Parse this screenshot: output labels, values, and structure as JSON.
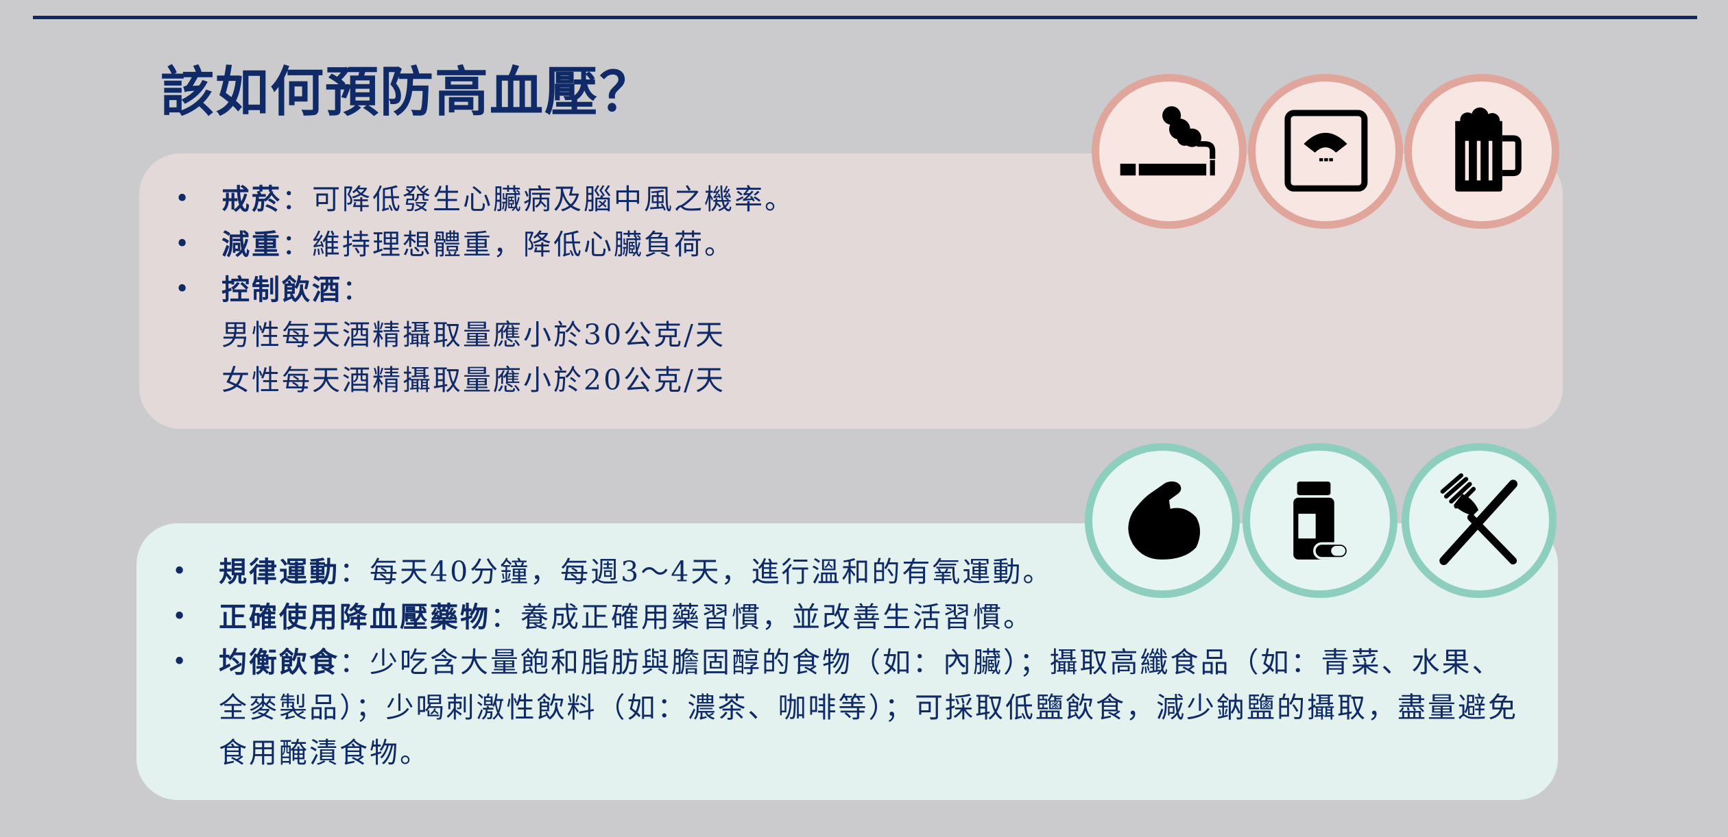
{
  "title": "該如何預防高血壓？",
  "top_section": {
    "items": [
      {
        "term": "戒菸",
        "text": "：可降低發生心臟病及腦中風之機率。",
        "sub": []
      },
      {
        "term": "減重",
        "text": "：維持理想體重，降低心臟負荷。",
        "sub": []
      },
      {
        "term": "控制飲酒",
        "text": "：",
        "sub": [
          "男性每天酒精攝取量應小於30公克/天",
          "女性每天酒精攝取量應小於20公克/天"
        ]
      }
    ],
    "icons": [
      "cigarette-icon",
      "weight-scale-icon",
      "beer-mug-icon"
    ]
  },
  "bottom_section": {
    "items": [
      {
        "term": "規律運動",
        "text": "：每天40分鐘，每週3～4天，進行溫和的有氧運動。"
      },
      {
        "term": "正確使用降血壓藥物",
        "text": "：養成正確用藥習慣，並改善生活習慣。"
      },
      {
        "term": "均衡飲食",
        "text": "：少吃含大量飽和脂肪與膽固醇的食物（如：內臟）；攝取高纖食品（如：青菜、水果、全麥製品）；少喝刺激性飲料（如：濃茶、咖啡等）；可採取低鹽飲食，減少鈉鹽的攝取，盡量避免食用醃漬食物。"
      }
    ],
    "icons": [
      "flexed-arm-icon",
      "medicine-bottle-icon",
      "fork-knife-icon"
    ]
  },
  "colors": {
    "text": "#0f2a66",
    "background": "#cbcbcd",
    "top_panel": "#e2d9d8",
    "bottom_panel": "#e3f1ef",
    "salmon_ring": "#e0a69b",
    "teal_ring": "#8ecebf"
  }
}
